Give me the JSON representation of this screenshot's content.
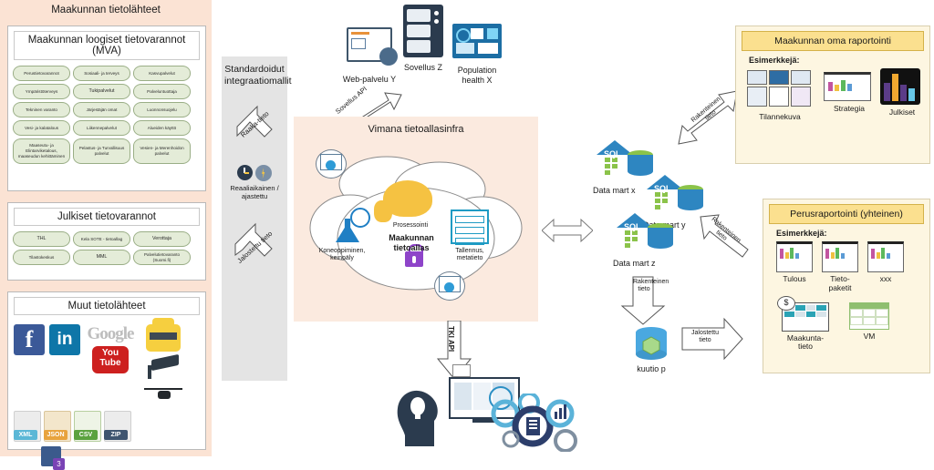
{
  "left_panel": {
    "title": "Maakunnan tietolähteet",
    "mva": {
      "title": "Maakunnan loogiset tietovarannot (MVA)",
      "items": [
        "Perustietovarannot",
        "Sosiaali- ja terveys",
        "Kasvupalvelut",
        "Ympäristöterveys",
        "Tukipalvelut",
        "Palveluntuottaja",
        "Tekninen varanto",
        "Järjestäjän omat",
        "Luonnonsuojelu",
        "Vesi- ja kalatalous",
        "Liikennepalvelut",
        "Alueiden käyttö",
        "Maaseutu- ja Elintarviketalous, maaseudun kehittäminen",
        "Pelastus- ja Turvallisuus palvelut",
        "Vesien- ja Merenhoidon palvelut"
      ]
    },
    "public": {
      "title": "Julkiset tietovarannot",
      "items": [
        "THL",
        "Kela SOTE - tietoallag",
        "Verottaja",
        "Tilastokeskus",
        "MML",
        "Palvelutietovaranto (Suomi.fi)"
      ]
    },
    "other": {
      "title": "Muut tietolähteet",
      "logos": [
        "facebook-logo",
        "linkedin-logo",
        "google-logo",
        "taxi-icon",
        "youtube-logo",
        "cctv-camera-icon",
        "xml-file-icon",
        "json-file-icon",
        "csv-file-icon",
        "zip-file-icon",
        "drone-icon",
        "ms-teams-icon"
      ],
      "file_labels": [
        "XML",
        "JSON",
        "CSV",
        "ZIP"
      ],
      "youtube_text": [
        "You",
        "Tube"
      ],
      "google_text": "Google"
    }
  },
  "standards": {
    "title": "Standardoidut integraatiomallit",
    "arrow_raw": "Raaka-tieto",
    "schedule_label": "Reaaliaikainen / ajastettu",
    "arrow_refined": "Jalostettu tieto"
  },
  "top_sources": [
    {
      "label": "Web-palvelu Y",
      "icon": "web-service-icon"
    },
    {
      "label": "Sovellus Z",
      "icon": "application-icon"
    },
    {
      "label": "Population health X",
      "icon": "dashboard-icon"
    }
  ],
  "api_labels": {
    "sovellus": "Sovellus API",
    "tki": "TKI API"
  },
  "infra": {
    "title": "Vimana tietoallasinfra",
    "lake_name": "Maakunnan tietoallas",
    "processing": "Prosessointi",
    "ml": "Koneoppiminen, keinoäly",
    "storage": "Tallennus, metatieto"
  },
  "data_marts": [
    {
      "label": "Data mart x",
      "db": "SQL"
    },
    {
      "label": "Data mart y",
      "db": "SQL"
    },
    {
      "label": "Data mart z",
      "db": "SQL"
    }
  ],
  "cube": {
    "label": "kuutio p"
  },
  "flow_arrows": {
    "structured_top": "Rakenteinen tieto",
    "structured_mid": "Rakenteinen tieto",
    "structured_down": "Rakenteinen tieto",
    "refined": "Jalostettu tieto"
  },
  "report_own": {
    "title": "Maakunnan oma raportointi",
    "examples_label": "Esimerkkejä:",
    "items": [
      "Tilannekuva",
      "Strategia",
      "Julkiset"
    ]
  },
  "report_basic": {
    "title": "Perusraportointi (yhteinen)",
    "examples_label": "Esimerkkejä:",
    "items": [
      "Tulous",
      "Tieto-paketit",
      "xxx",
      "Maakunta-tieto",
      "VM"
    ]
  },
  "colors": {
    "peach": "#fbe3d4",
    "infra_peach": "#fbeadf",
    "pill_green": "#e4ecd8",
    "panel_yellow": "#fdf6e1",
    "header_yellow": "#fbe08f",
    "std_gray": "#e4e4e4",
    "accent_blue": "#2e86c1"
  }
}
